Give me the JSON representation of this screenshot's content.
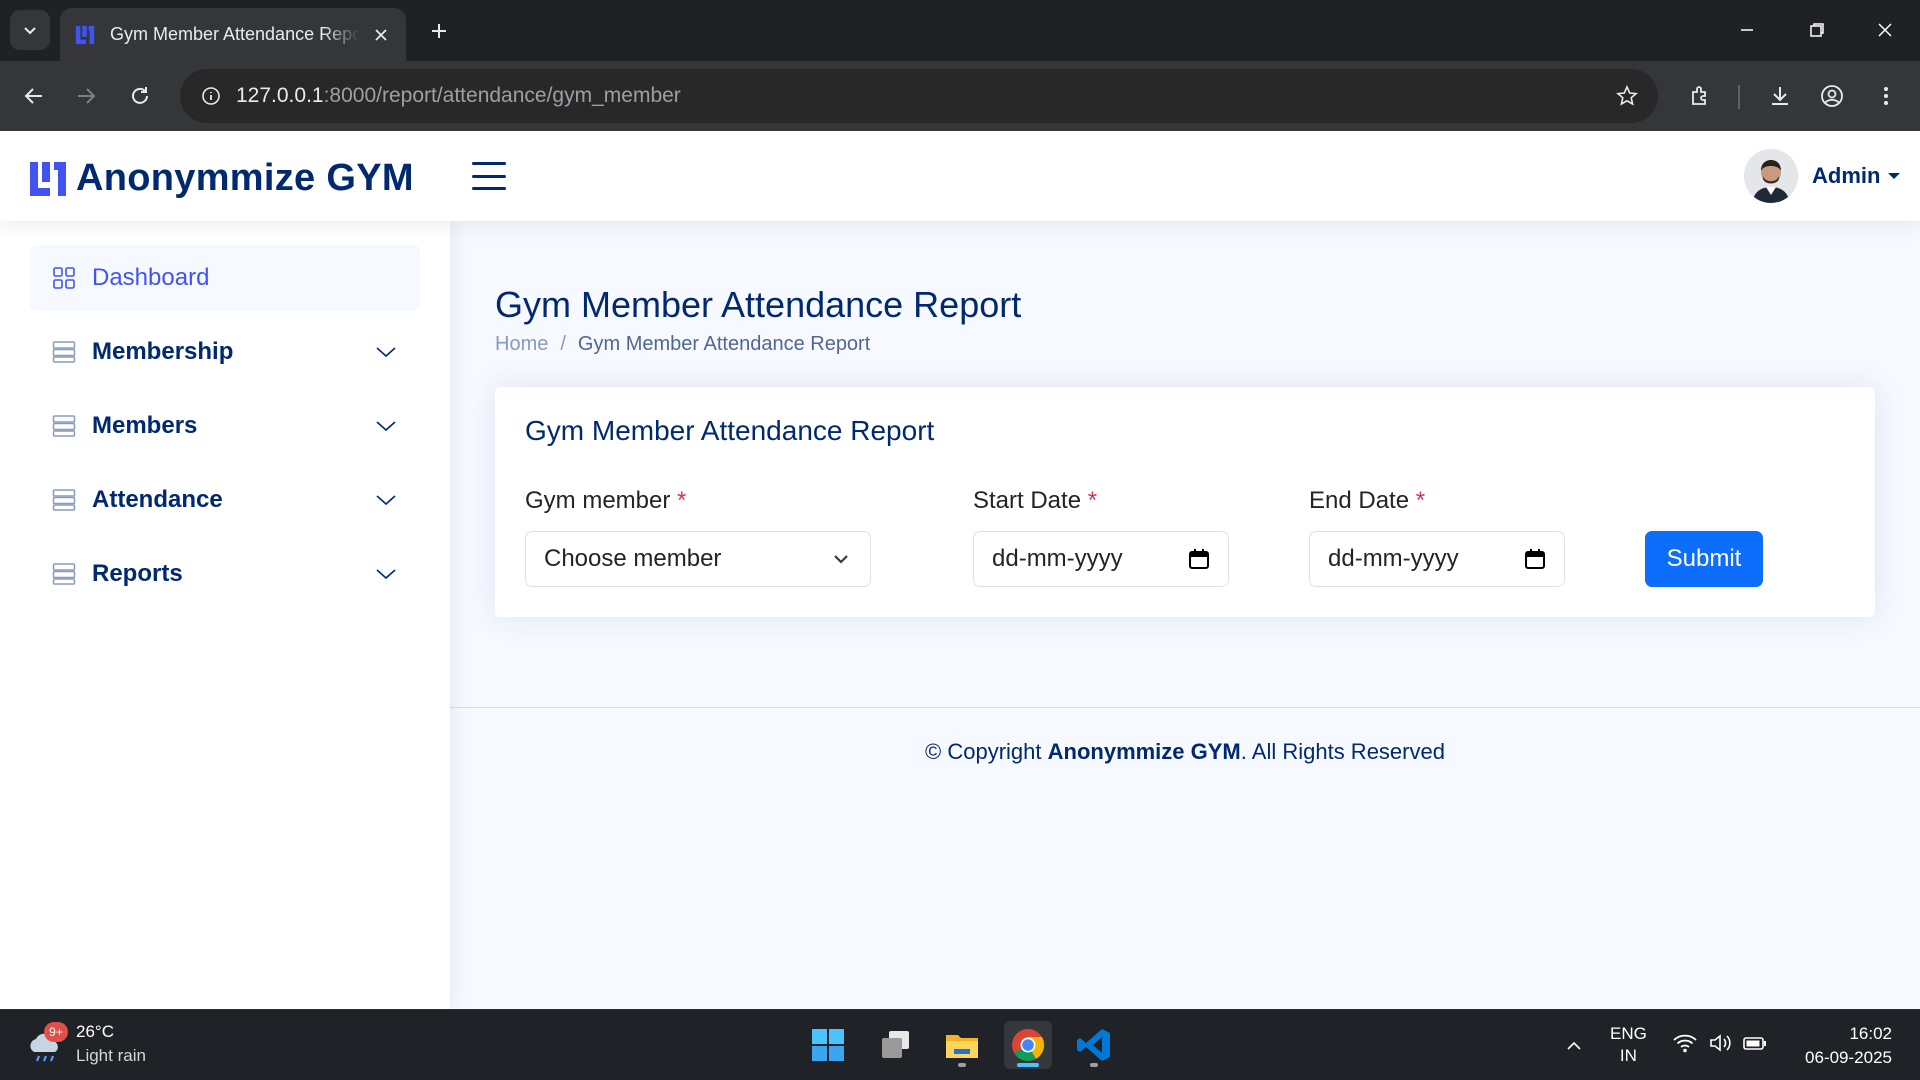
{
  "browser": {
    "tab_title": "Gym Member Attendance Report",
    "url_host": "127.0.0.1",
    "url_rest": ":8000/report/attendance/gym_member"
  },
  "header": {
    "brand": "Anonymmize GYM",
    "profile_name": "Admin"
  },
  "sidebar": {
    "items": [
      {
        "label": "Dashboard"
      },
      {
        "label": "Membership"
      },
      {
        "label": "Members"
      },
      {
        "label": "Attendance"
      },
      {
        "label": "Reports"
      }
    ]
  },
  "main": {
    "page_title": "Gym Member Attendance Report",
    "breadcrumb_home": "Home",
    "breadcrumb_sep": "/",
    "breadcrumb_current": "Gym Member Attendance Report",
    "card_title": "Gym Member Attendance Report",
    "form": {
      "member_label": "Gym member",
      "member_selected": "Choose member",
      "start_label": "Start Date",
      "start_value": "dd-mm-yyyy",
      "end_label": "End Date",
      "end_value": "dd-mm-yyyy",
      "required_mark": "*",
      "submit_label": "Submit"
    }
  },
  "footer": {
    "prefix": "© Copyright ",
    "brand": "Anonymmize GYM",
    "suffix": ". All Rights Reserved"
  },
  "taskbar": {
    "weather_badge": "9+",
    "temperature": "26°C",
    "condition": "Light rain",
    "lang_line1": "ENG",
    "lang_line2": "IN",
    "time": "16:02",
    "date": "06-09-2025"
  },
  "colors": {
    "brand_navy": "#012970",
    "accent_blue": "#4154f1",
    "submit_blue": "#0d6efd",
    "required_red": "#dc3545"
  }
}
